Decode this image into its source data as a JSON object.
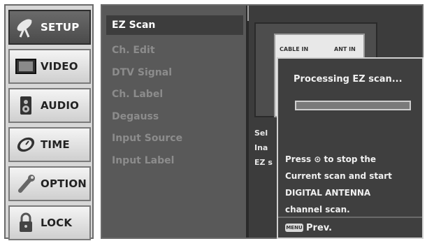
{
  "sidebar": {
    "tabs": [
      {
        "label": "SETUP",
        "icon": "satellite-dish-icon",
        "active": true
      },
      {
        "label": "VIDEO",
        "icon": "monitor-icon",
        "active": false
      },
      {
        "label": "AUDIO",
        "icon": "speaker-icon",
        "active": false
      },
      {
        "label": "TIME",
        "icon": "clock-icon",
        "active": false
      },
      {
        "label": "OPTION",
        "icon": "wrench-icon",
        "active": false
      },
      {
        "label": "LOCK",
        "icon": "padlock-icon",
        "active": false
      }
    ]
  },
  "menu": {
    "items": [
      {
        "label": "EZ Scan",
        "selected": true
      },
      {
        "label": "Ch. Edit",
        "selected": false
      },
      {
        "label": "DTV Signal",
        "selected": false
      },
      {
        "label": "Ch. Label",
        "selected": false
      },
      {
        "label": "Degauss",
        "selected": false
      },
      {
        "label": "Input Source",
        "selected": false
      },
      {
        "label": "Input Label",
        "selected": false
      }
    ]
  },
  "diagram": {
    "cable_in": "CABLE IN",
    "ant_in": "ANT IN"
  },
  "description": {
    "lines": [
      "Sel",
      "Ina",
      "EZ s"
    ]
  },
  "popup": {
    "title": "Processing EZ scan...",
    "progress": 0,
    "lines": [
      "Press ⊙ to stop the",
      "Current scan and start",
      "DIGITAL ANTENNA",
      "channel scan."
    ],
    "menu_key": "MENU",
    "prev_label": "Prev."
  },
  "colors": {
    "menu_bg": "#595959",
    "panel_bg": "#3c3c3c",
    "active_tab": "#4b4b4b",
    "inactive_item_text": "#8c8c8c"
  }
}
